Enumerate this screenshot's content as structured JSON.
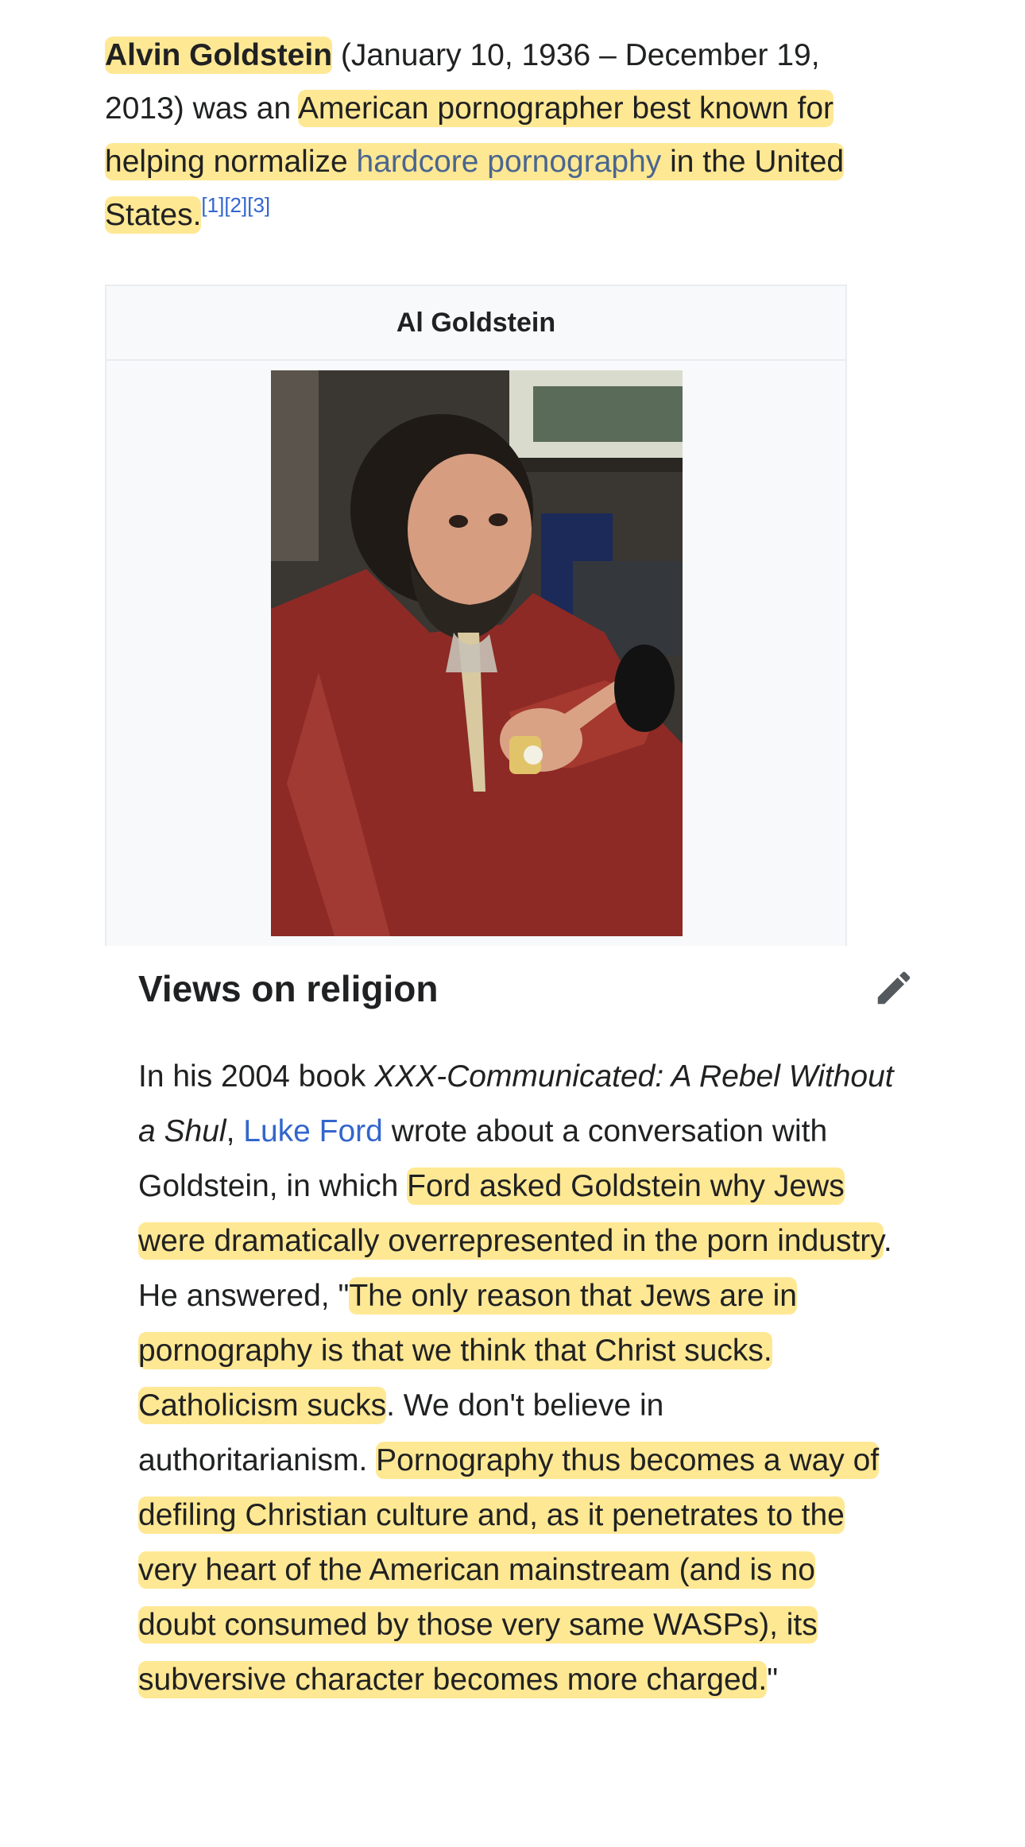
{
  "intro": {
    "name": "Alvin Goldstein",
    "dates": " (January 10, 1936 – December 19, 2013) was an ",
    "hl_part1": "American pornographer best known for helping normalize ",
    "link_hardcore": "hardcore pornography",
    "hl_part2": " in the United States.",
    "refs": "[1][2][3]"
  },
  "infobox": {
    "caption": "Al Goldstein"
  },
  "section": {
    "title": "Views on religion"
  },
  "paragraph": {
    "t1": "In his 2004 book ",
    "book_title": "XXX-Communicated: A Rebel Without a Shul",
    "t2": ", ",
    "link_ford": "Luke Ford",
    "t3": " wrote about a conversation with Goldstein, in which ",
    "hl1": "Ford asked Goldstein why Jews were dramatically overrepresented in the porn industry",
    "t4": ". He answered, \"",
    "hl2": "The only reason that Jews are in pornography is that we think that Christ sucks. Catholicism sucks",
    "t5": ". We don't believe in authoritarianism. ",
    "hl3": "Pornography thus becomes a way of defiling Christian culture and, as it penetrates to the very heart of the American mainstream (and is no doubt consumed by those very same WASPs), its subversive character becomes more charged.",
    "t6": "\""
  },
  "colors": {
    "highlight": "#ffd53c",
    "link": "#3366cc",
    "text": "#202122",
    "infobox_bg": "#f8f9fa",
    "photo_shirt": "#8d2a25"
  }
}
